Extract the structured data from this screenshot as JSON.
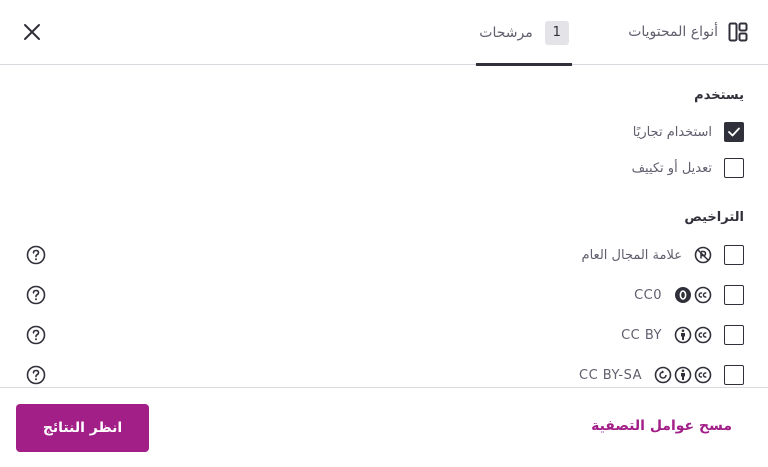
{
  "header": {
    "close_icon": "close-icon",
    "content_types_tab": {
      "label": "أنواع المحتويات",
      "icon": "layout-icon"
    },
    "filters_tab": {
      "label": "مرشحات",
      "count": "1"
    }
  },
  "use_section": {
    "title": "يستخدم",
    "items": [
      {
        "label": "استخدام تجاريًا",
        "checked": true
      },
      {
        "label": "تعديل أو تكييف",
        "checked": false
      }
    ]
  },
  "licenses_section": {
    "title": "التراخيص",
    "items": [
      {
        "label": "علامة المجال العام",
        "icons": [
          "pd-icon"
        ]
      },
      {
        "label": "CC0",
        "icons": [
          "cc-icon",
          "zero-icon"
        ]
      },
      {
        "label": "CC BY",
        "icons": [
          "cc-icon",
          "by-icon"
        ]
      },
      {
        "label": "CC BY-SA",
        "icons": [
          "cc-icon",
          "by-icon",
          "sa-icon"
        ]
      }
    ]
  },
  "footer": {
    "see_results": "انظر النتائج",
    "clear_filters": "مسح عوامل التصفية"
  },
  "colors": {
    "accent": "#a31f88",
    "text": "#30303a",
    "muted": "#5f5f6e"
  }
}
